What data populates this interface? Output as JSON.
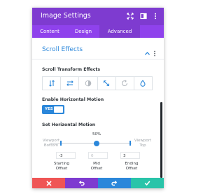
{
  "window": {
    "title": "Image Settings",
    "header_icons": [
      "expand-icon",
      "sidebar-toggle-icon",
      "more-menu-icon"
    ]
  },
  "tabs": [
    {
      "label": "Content",
      "active": false
    },
    {
      "label": "Design",
      "active": false
    },
    {
      "label": "Advanced",
      "active": true
    }
  ],
  "section": {
    "title": "Scroll Effects",
    "collapse_icon": "chevron-up-icon",
    "menu_icon": "more-menu-icon"
  },
  "scroll_transform": {
    "label": "Scroll Transform Effects",
    "effects": [
      {
        "name": "vertical-motion-icon",
        "active": true
      },
      {
        "name": "horizontal-motion-icon",
        "active": true
      },
      {
        "name": "fading-icon",
        "active": false
      },
      {
        "name": "scaling-icon",
        "active": true
      },
      {
        "name": "rotating-icon",
        "active": false
      },
      {
        "name": "blur-icon",
        "active": true
      }
    ]
  },
  "horizontal_motion": {
    "toggle_label": "Enable Horizontal Motion",
    "toggle_value": "YES",
    "enabled": true
  },
  "set_motion": {
    "label": "Set Horizontal Motion",
    "start_label": [
      "Viewport",
      "Bottom"
    ],
    "end_label": [
      "Viewport",
      "Top"
    ],
    "mid_percent": "50%",
    "starting_offset": "-3",
    "mid_offset": "0",
    "ending_offset": "3",
    "starting_caption": [
      "Starting",
      "Offset"
    ],
    "mid_caption": [
      "Mid",
      "Offset"
    ],
    "ending_caption": [
      "Ending",
      "Offset"
    ]
  },
  "footer": {
    "buttons": [
      {
        "name": "discard-button",
        "icon": "close-icon",
        "color": "#ef5555"
      },
      {
        "name": "undo-button",
        "icon": "undo-icon",
        "color": "#7e3bd0"
      },
      {
        "name": "redo-button",
        "icon": "redo-icon",
        "color": "#2b87da"
      },
      {
        "name": "save-button",
        "icon": "check-icon",
        "color": "#29c4a9"
      }
    ]
  },
  "colors": {
    "header": "#7e3bd0",
    "tabs": "#8f42ec",
    "accent": "#2b87da"
  }
}
